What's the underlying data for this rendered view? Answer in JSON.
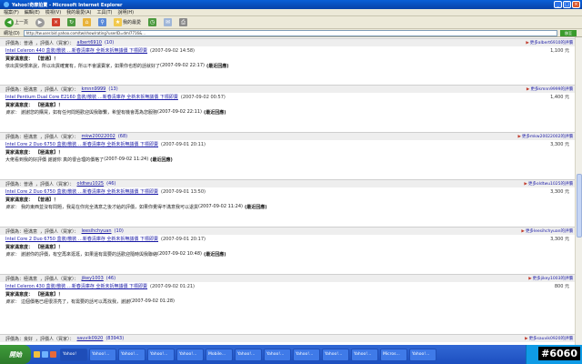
{
  "window": {
    "title": "Yahoo!奇摩拍賣 - Microsoft Internet Explorer",
    "minimize_glyph": "_",
    "maximize_glyph": "□",
    "close_glyph": "×"
  },
  "menu": [
    "檔案(F)",
    "編輯(E)",
    "檢視(V)",
    "我的最愛(A)",
    "工具(T)",
    "說明(H)"
  ],
  "toolbar": {
    "back_label": "上一頁",
    "favorites_label": "我的最愛"
  },
  "address": {
    "label": "網址(D)",
    "url": "http://tw.user.bid.yahoo.com/tw/show/rating?userID=dml7716&...",
    "go_label": "移至"
  },
  "entries": [
    {
      "rating": "評價為：普通",
      "rater_label": "，評價人（買家）：",
      "buyer": "albert6910",
      "score": "(10)",
      "more": "更多albert6910的評價",
      "product": "Intel Celeron 440 盒裝/散裝 …新春清庫存 全新未拆無議價 下標即賣",
      "date": "(2007-09-02 14:58)",
      "price": "1,100 元",
      "reply_label": "買家滿意度：",
      "reply_tag": "【普通】！",
      "comment_label": "",
      "comment": "依出貨快慢來說，所以出貨確實有，所以不會讓賣家，如果你也想的話就好了",
      "comment_date": "(2007-09-02 22:17)",
      "latest": "(最近回應)"
    },
    {
      "rating": "評價為：極滿意",
      "rater_label": "，評價人（買家）：",
      "buyer": "kmnn9999",
      "score": "(13)",
      "more": "更多kmnn9999的評價",
      "product": "Intel Pentium Dual Core E2160 盒裝/散裝 …新春清庫存 全新未拆無議價 下標即賣",
      "date": "(2007-09-02 00:57)",
      "price": "1,400 元",
      "reply_label": "買家滿意度：",
      "reply_tag": "【極滿意】！",
      "comment_label": "賣家：",
      "comment": "謝謝您的購買，如有任何問題歡迎與我聯繫，希望有機會再為您服務",
      "comment_date": "(2007-09-02 22:11)",
      "latest": "(最近回應)"
    },
    {
      "rating": "評價為：極滿意",
      "rater_label": "，評價人（買家）：",
      "buyer": "mkw20022002",
      "score": "(68)",
      "more": "更多mkw20022002的評價",
      "product": "Intel Core 2 Duo 6750 盒裝/散裝 …新春清庫存 全新未拆無議價 下標即賣",
      "date": "(2007-09-01 20:11)",
      "price": "3,300 元",
      "reply_label": "買家滿意度：",
      "reply_tag": "【極滿意】！",
      "comment_label": "",
      "comment": "大佬看到我的好評價 謝謝你 真的很合理的價格了",
      "comment_date": "(2007-09-02 11:24)",
      "latest": "(最近回應)"
    },
    {
      "rating": "評價為：普通",
      "rater_label": "，評價人（買家）：",
      "buyer": "oldtwu1025",
      "score": "(46)",
      "more": "更多oldtwu1025的評價",
      "product": "Intel Core 2 Duo 6750 盒裝/散裝 …新春清庫存 全新未拆無議價 下標即賣",
      "date": "(2007-09-01 13:50)",
      "price": "3,300 元",
      "reply_label": "買家滿意度：",
      "reply_tag": "【普通】！",
      "comment_label": "賣家：",
      "comment": "我的東西並沒有問題，我是在你完全滿意之後才給的評價，如果你覺得不滿意我可以退貨",
      "comment_date": "(2007-09-02 11:24)",
      "latest": "(最近回應)"
    },
    {
      "rating": "評價為：極滿意",
      "rater_label": "，評價人（買家）：",
      "buyer": "leesihchyuan",
      "score": "(10)",
      "more": "更多leesihchyuan的評價",
      "product": "Intel Core 2 Duo 6750 盒裝/散裝 …新春清庫存 全新未拆無議價 下標即賣",
      "date": "(2007-09-01 20:17)",
      "price": "3,300 元",
      "reply_label": "買家滿意度：",
      "reply_tag": "【極滿意】！",
      "comment_label": "賣家：",
      "comment": "謝謝你的評價，有空再來逛逛，如果還有需要的話歡迎隨時與我聯絡",
      "comment_date": "(2007-09-02 10:48)",
      "latest": "(最近回應)"
    },
    {
      "rating": "評價為：極滿意",
      "rater_label": "，評價人（買家）：",
      "buyer": "jikey1003",
      "score": "(46)",
      "more": "更多jikey1003的評價",
      "product": "Intel Celeron 430 盒裝/散裝 …新春清庫存 全新未拆無議價 下標即賣",
      "date": "(2007-09-02 01:21)",
      "price": "800 元",
      "reply_label": "買家滿意度：",
      "reply_tag": "【極滿意】！",
      "comment_label": "賣家：",
      "comment": "這個價格已經很漂亮了，有需要的話可以再找我，謝謝",
      "comment_date": "(2007-09-02 01:28)",
      "latest": ""
    },
    {
      "rating": "評價為：良好",
      "rater_label": "，評價人（買家）：",
      "buyer": "sauvik0920",
      "score": "(83943)",
      "more": "更多sauvik0920的評價",
      "product": "",
      "date": "",
      "price": "",
      "reply_label": "",
      "reply_tag": "",
      "comment_label": "",
      "comment": "",
      "comment_date": "",
      "latest": ""
    }
  ],
  "taskbar": {
    "start_label": "開始",
    "tasks": [
      "Yahoo!",
      "Yahoo!...",
      "Yahoo!...",
      "Yahoo!...",
      "Yahoo!...",
      "Mobile...",
      "Yahoo!...",
      "Yahoo!...",
      "Yahoo!...",
      "Yahoo!...",
      "Yahoo!...",
      "Micros...",
      "Yahoo!..."
    ]
  },
  "watermark": "#6060"
}
